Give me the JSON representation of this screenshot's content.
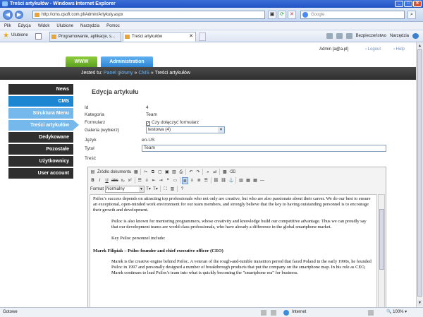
{
  "window": {
    "title": "Treści artykułów - Windows Internet Explorer"
  },
  "addressbar": {
    "url": "http://cms.qsoft.com.pl/Admin/Artykuly.aspx",
    "search_placeholder": "Google"
  },
  "menubar": [
    "Plik",
    "Edycja",
    "Widok",
    "Ulubione",
    "Narzędzia",
    "Pomoc"
  ],
  "favbar": {
    "label": "Ulubione",
    "tabs": [
      {
        "label": "Programowanie, aplikacje, s..."
      },
      {
        "label": "Treści artykułów"
      }
    ],
    "commands": [
      "Bezpieczeństwo",
      "Narzędzia"
    ]
  },
  "header": {
    "user": "Admin [a@a.pl]",
    "logout": "Logout",
    "help": "Help",
    "btn_www": "WWW",
    "btn_admin": "Administration"
  },
  "breadcrumb": {
    "prefix": "Jesteś tu:",
    "home": "Panel główny",
    "sep": "»",
    "cms": "CMS",
    "current": "Treści artykułów"
  },
  "sidebar": {
    "items": [
      {
        "label": "News"
      },
      {
        "label": "CMS"
      },
      {
        "label": "Struktura Menu"
      },
      {
        "label": "Treści artykułów"
      },
      {
        "label": "Dedykowane"
      },
      {
        "label": "Pozostałe"
      },
      {
        "label": "Użytkownicy"
      },
      {
        "label": "User account"
      }
    ]
  },
  "form": {
    "title": "Edycja artykułu",
    "id_label": "Id",
    "id_value": "4",
    "kategoria_label": "Kategoria",
    "kategoria_value": "Team",
    "formularz_label": "Formularz",
    "formularz_check": "Czy dołączyć formularz",
    "galeria_label": "Galeria (wybierz)",
    "galeria_value": "testowa (4)",
    "jezyk_label": "Język",
    "jezyk_value": "en-US",
    "tytul_label": "Tytuł",
    "tytul_value": "Team",
    "tresc_label": "Treść"
  },
  "editor": {
    "source_label": "Źródło dokumentu",
    "format_label": "Format",
    "format_value": "Normalny",
    "p1": "Psiloc's success depends on attracting top professionals who not only are creative, but who are also passionate about their career. We do our best to ensure an exceptional, open-minded work environment for our team members, and strongly believe that the key to having outstanding personnel is to encourage their growth and development.",
    "p2": "Psiloc is also known for mentoring programmers, whose creativity and knowledge build our competitive advantage. Thus we can proudly say that our development teams are world class professionals, who have already a difference in the global smartphone market.",
    "p3": "Key Psiloc personnel include:",
    "h1": "Marek Filipiak – Psiloc founder and chief executive officer (CEO)",
    "p4": "Marek is the creative engine behind Psiloc. A veteran of the rough-and-tumble transition period that faced Poland in the early 1990s, he founded Psiloc in 1997 and personally designed a number of breakthrough products that put the company on the smartphone map. In his role as CEO, Marek continues to lead Psiloc's team into what is quickly becoming the \"smartphone era\" for business."
  },
  "statusbar": {
    "status": "Gotowe",
    "zone": "Internet",
    "zoom": "100%"
  }
}
